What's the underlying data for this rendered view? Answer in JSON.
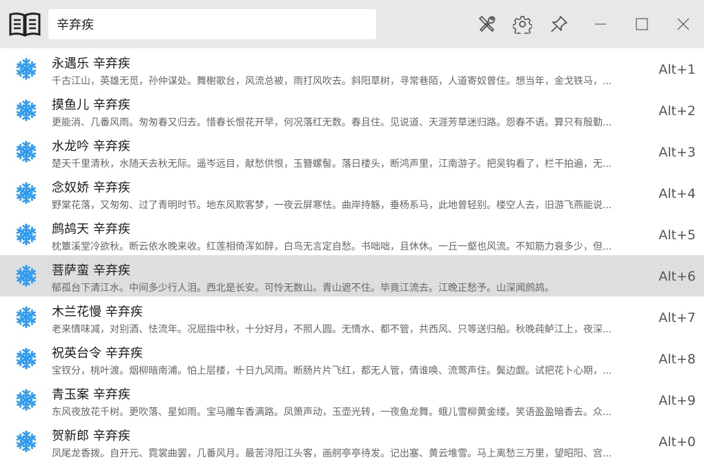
{
  "search": {
    "value": "辛弃疾",
    "placeholder": ""
  },
  "toolbar": {
    "tools_icon": "tools-icon",
    "settings_icon": "gear-icon",
    "pin_icon": "pin-icon",
    "minimize_icon": "minimize-icon",
    "maximize_icon": "maximize-icon",
    "close_icon": "close-icon"
  },
  "colors": {
    "accent": "#2f9bf0",
    "topbar": "#e8e8e8",
    "selected_row": "#dedede"
  },
  "results": [
    {
      "title": "永遇乐 辛弃疾",
      "excerpt": "千古江山，英雄无觅，孙仲谋处。舞榭歌台，风流总被，雨打风吹去。斜阳草树，寻常巷陌，人道寄奴曾住。想当年，金戈铁马，...",
      "hotkey": "Alt+1",
      "selected": false
    },
    {
      "title": "摸鱼儿 辛弃疾",
      "excerpt": "更能消、几番风雨。匆匆春又归去。惜春长恨花开早，何况落红无数。春且住。见说道、天涯芳草迷归路。怨春不语。算只有殷勤...",
      "hotkey": "Alt+2",
      "selected": false
    },
    {
      "title": "水龙吟 辛弃疾",
      "excerpt": "楚天千里清秋，水随天去秋无际。遥岑远目，献愁供恨，玉簪螺髻。落日楼头，断鸿声里，江南游子。把吴钩看了，栏干拍遍，无...",
      "hotkey": "Alt+3",
      "selected": false
    },
    {
      "title": "念奴娇 辛弃疾",
      "excerpt": "野棠花落，又匆匆、过了青明时节。地东风欺客梦，一夜云屏寒怯。曲岸持觞，垂杨系马，此地曾轻别。楼空人去，旧游飞燕能说...",
      "hotkey": "Alt+4",
      "selected": false
    },
    {
      "title": "鹧鸪天 辛弃疾",
      "excerpt": "枕簟溪堂冷欲秋。断云依水晚来收。红莲相倚浑如醉，白鸟无言定自愁。书咄咄，且休休。一丘一壑也风流。不知筋力衰多少，但...",
      "hotkey": "Alt+5",
      "selected": false
    },
    {
      "title": "菩萨蛮 辛弃疾",
      "excerpt": "郁孤台下清江水。中间多少行人泪。西北是长安。可怜无数山。青山遮不住。毕竟江流去。江晚正愁予。山深闻鹧鸪。",
      "hotkey": "Alt+6",
      "selected": true
    },
    {
      "title": "木兰花慢 辛弃疾",
      "excerpt": "老来情味减，对别酒、怯流年。况屈指中秋，十分好月，不照人圆。无情水、都不管，共西风、只等送归船。秋晚莼鲈江上，夜深...",
      "hotkey": "Alt+7",
      "selected": false
    },
    {
      "title": "祝英台令 辛弃疾",
      "excerpt": "宝钗分，桃叶渡。烟柳暗南浦。怕上层楼，十日九风雨。断肠片片飞红，都无人管，倩谁唤、流莺声住。鬓边觑。试把花卜心期，...",
      "hotkey": "Alt+8",
      "selected": false
    },
    {
      "title": "青玉案 辛弃疾",
      "excerpt": "东风夜放花千树。更吹落、星如雨。宝马雕车香满路。凤箫声动，玉壶光转，一夜鱼龙舞。蛾儿雪柳黄金缕。笑语盈盈暗香去。众...",
      "hotkey": "Alt+9",
      "selected": false
    },
    {
      "title": "贺新郎 辛弃疾",
      "excerpt": "凤尾龙香拨。自开元、霓裳曲罢，几番风月。最苦浔阳江头客，画舸亭亭待发。记出塞、黄云堆雪。马上离愁三万里，望昭阳、宫...",
      "hotkey": "Alt+0",
      "selected": false
    }
  ]
}
